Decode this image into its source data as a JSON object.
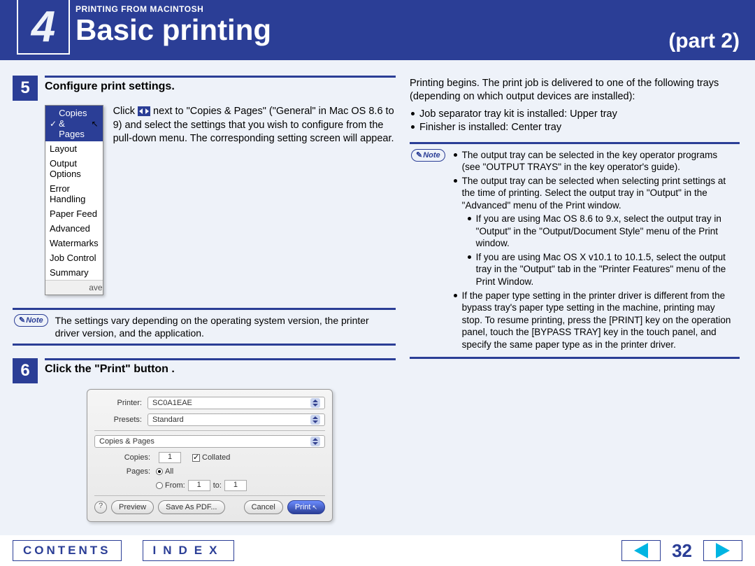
{
  "header": {
    "chapter_num": "4",
    "breadcrumb": "PRINTING FROM MACINTOSH",
    "title": "Basic printing",
    "part": "(part 2)"
  },
  "step5": {
    "num": "5",
    "title": "Configure print settings.",
    "menu": {
      "sel": "Copies & Pages",
      "items": [
        "Layout",
        "Output Options",
        "Error Handling",
        "Paper Feed",
        "Advanced",
        "Watermarks",
        "Job Control",
        "Summary"
      ],
      "save": "ave"
    },
    "text_a": "Click ",
    "text_b": " next to \"Copies & Pages\" (\"General\" in Mac OS 8.6 to 9) and select the settings that you wish to configure from the pull-down menu. The corresponding setting screen will appear.",
    "note_label": "Note",
    "note": "The settings vary depending on the operating system version, the printer driver version, and the application."
  },
  "step6": {
    "num": "6",
    "title": "Click the \"Print\" button .",
    "dialog": {
      "printer_lbl": "Printer:",
      "printer_val": "SC0A1EAE",
      "presets_lbl": "Presets:",
      "presets_val": "Standard",
      "section": "Copies & Pages",
      "copies_lbl": "Copies:",
      "copies_val": "1",
      "collated": "Collated",
      "pages_lbl": "Pages:",
      "all": "All",
      "from": "From:",
      "from_val": "1",
      "to": "to:",
      "to_val": "1",
      "help": "?",
      "preview": "Preview",
      "saveas": "Save As PDF...",
      "cancel": "Cancel",
      "print": "Print"
    }
  },
  "right": {
    "intro": "Printing begins. The print job is delivered to one of the following trays (depending on which output devices are installed):",
    "b1": "Job separator tray kit is installed: Upper tray",
    "b2": "Finisher is installed: Center tray",
    "note_label": "Note",
    "n1": "The output tray can be selected in the key operator programs (see \"OUTPUT TRAYS\" in the key operator's guide).",
    "n2": "The output tray can be selected when selecting print settings at the time of printing. Select the output tray in \"Output\" in the \"Advanced\" menu of the Print window.",
    "n2a": "If you are using Mac OS 8.6 to 9.x, select the output tray in \"Output\" in the \"Output/Document Style\" menu of the Print window.",
    "n2b": "If you are using Mac OS X v10.1 to 10.1.5, select the output tray in the \"Output\" tab in the \"Printer Features\" menu of the Print Window.",
    "n3": "If the paper type setting in the printer driver is different from the bypass tray's paper type setting in the machine, printing may stop. To resume printing, press the [PRINT] key on the operation panel, touch the [BYPASS TRAY] key in the touch panel, and specify the same paper type as in the printer driver."
  },
  "footer": {
    "contents": "CONTENTS",
    "index": "INDEX",
    "page": "32"
  }
}
